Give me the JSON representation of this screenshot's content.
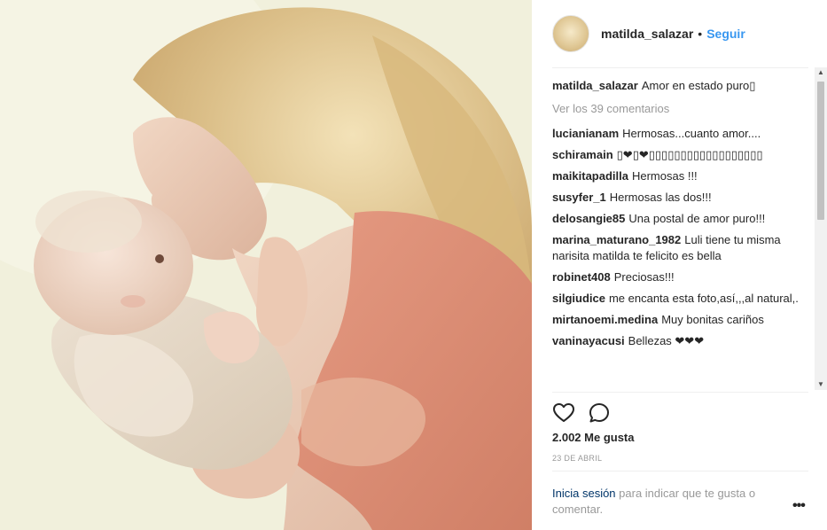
{
  "header": {
    "username": "matilda_salazar",
    "separator": "•",
    "follow_label": "Seguir"
  },
  "caption": {
    "username": "matilda_salazar",
    "text": "Amor en estado puro▯"
  },
  "view_all_label": "Ver los 39 comentarios",
  "comments": [
    {
      "user": "lucianianam",
      "text": "Hermosas...cuanto amor...."
    },
    {
      "user": "schiramain",
      "text": "▯❤▯❤▯▯▯▯▯▯▯▯▯▯▯▯▯▯▯▯▯▯"
    },
    {
      "user": "maikitapadilla",
      "text": "Hermosas !!!"
    },
    {
      "user": "susyfer_1",
      "text": "Hermosas las dos!!!"
    },
    {
      "user": "delosangie85",
      "text": "Una postal de amor puro!!!"
    },
    {
      "user": "marina_maturano_1982",
      "text": "Luli tiene tu misma narisita matilda te felicito es bella"
    },
    {
      "user": "robinet408",
      "text": "Preciosas!!!"
    },
    {
      "user": "silgiudice",
      "text": "me encanta esta foto,así,,,al natural,."
    },
    {
      "user": "mirtanoemi.medina",
      "text": "Muy bonitas cariños"
    },
    {
      "user": "vaninayacusi",
      "text": "Bellezas ❤❤❤"
    }
  ],
  "likes_label": "2.002 Me gusta",
  "date_label": "23 DE ABRIL",
  "login": {
    "link_label": "Inicia sesión",
    "rest_label": " para indicar que te gusta o comentar."
  },
  "more_label": "•••",
  "icons": {
    "like": "heart-icon",
    "comment": "comment-icon",
    "scroll_up": "scroll-up-arrow",
    "scroll_down": "scroll-down-arrow"
  },
  "colors": {
    "link": "#3897f0",
    "muted": "#999999",
    "text": "#262626",
    "login_link": "#003569"
  }
}
